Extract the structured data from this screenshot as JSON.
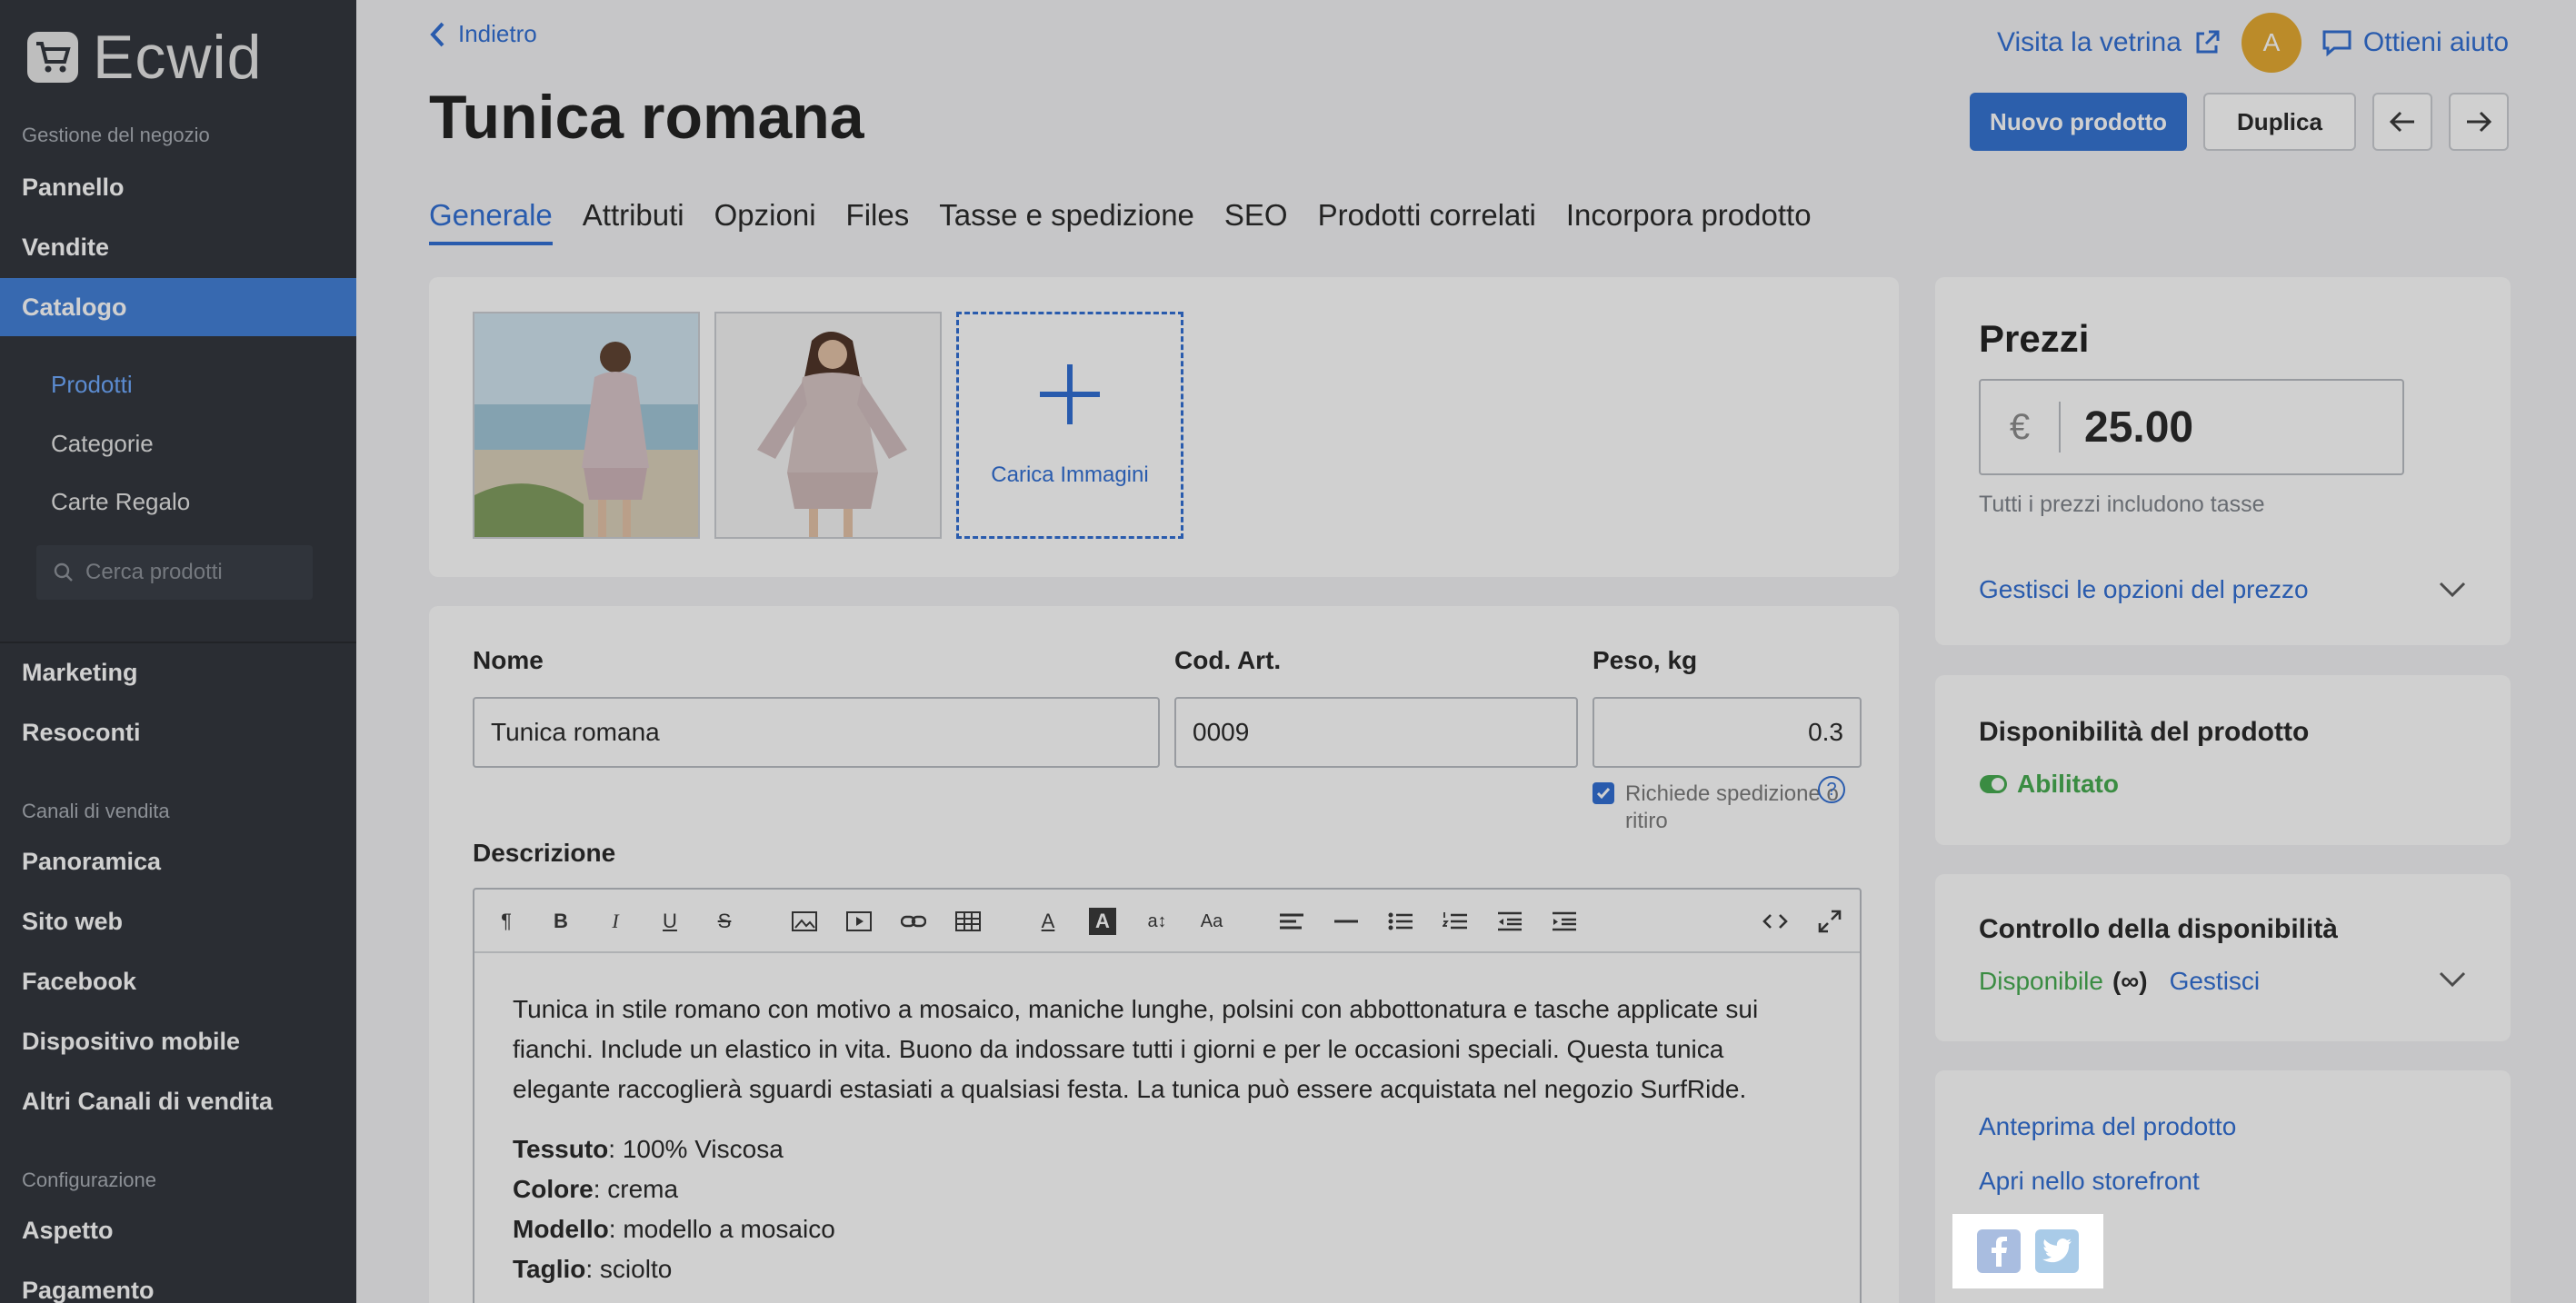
{
  "sidebar": {
    "logo_text": "Ecwid",
    "section_store": "Gestione del negozio",
    "items_top": [
      "Pannello",
      "Vendite",
      "Catalogo"
    ],
    "catalog_sub": [
      "Prodotti",
      "Categorie",
      "Carte Regalo"
    ],
    "search_placeholder": "Cerca prodotti",
    "items_mid": [
      "Marketing",
      "Resoconti"
    ],
    "section_channels": "Canali di vendita",
    "channels": [
      "Panoramica",
      "Sito web",
      "Facebook",
      "Dispositivo mobile",
      "Altri Canali di vendita"
    ],
    "section_config": "Configurazione",
    "config": [
      "Aspetto",
      "Pagamento"
    ]
  },
  "header": {
    "back_label": "Indietro",
    "title": "Tunica romana",
    "visit_store": "Visita la vetrina",
    "avatar_letter": "A",
    "help": "Ottieni aiuto",
    "new_product": "Nuovo prodotto",
    "duplicate": "Duplica"
  },
  "tabs": [
    "Generale",
    "Attributi",
    "Opzioni",
    "Files",
    "Tasse e spedizione",
    "SEO",
    "Prodotti correlati",
    "Incorpora prodotto"
  ],
  "images": {
    "upload_label": "Carica Immagini"
  },
  "form": {
    "name_label": "Nome",
    "name_value": "Tunica romana",
    "sku_label": "Cod. Art.",
    "sku_value": "0009",
    "weight_label": "Peso, kg",
    "weight_value": "0.3",
    "shipping_check": "Richiede spedizione o ritiro",
    "help_mark": "?",
    "desc_label": "Descrizione",
    "desc_paragraph": "Tunica in stile romano con motivo a mosaico, maniche lunghe, polsini con abbottonatura e tasche applicate sui fianchi. Include un elastico in vita. Buono da indossare tutti i giorni e per le occasioni speciali. Questa tunica elegante raccoglierà sguardi estasiati a qualsiasi festa. La tunica può essere acquistata nel negozio SurfRide.",
    "specs": [
      {
        "k": "Tessuto",
        "v": ": 100% Viscosa"
      },
      {
        "k": "Colore",
        "v": ": crema"
      },
      {
        "k": "Modello",
        "v": ": modello a mosaico"
      },
      {
        "k": "Taglio",
        "v": ": sciolto"
      }
    ]
  },
  "pricing": {
    "title": "Prezzi",
    "currency": "€",
    "price": "25.00",
    "tax_note": "Tutti i prezzi includono tasse",
    "manage_options": "Gestisci le opzioni del prezzo"
  },
  "availability": {
    "title": "Disponibilità del prodotto",
    "status": "Abilitato"
  },
  "stock": {
    "title": "Controllo della disponibilità",
    "status": "Disponibile",
    "infinite": "(∞)",
    "manage": "Gestisci"
  },
  "links": {
    "preview": "Anteprima del prodotto",
    "open_storefront": "Apri nello storefront"
  },
  "colors": {
    "accent": "#2a6ad3",
    "sidebar": "#2b2f36",
    "green": "#3fa84a"
  }
}
